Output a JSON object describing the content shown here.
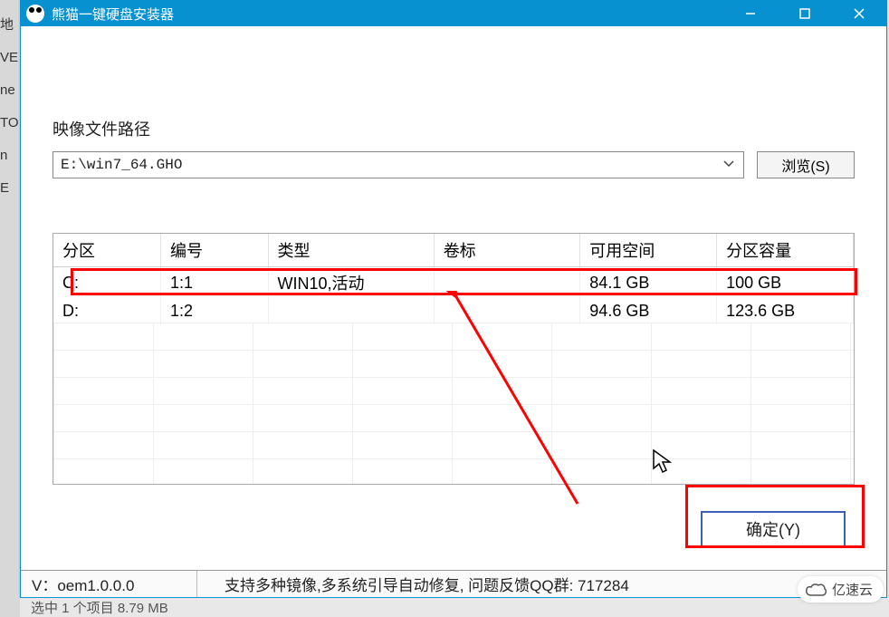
{
  "app_title": "熊猫一键硬盘安装器",
  "left_strip_text": "地\nVE\nne\nTO\nn\nE",
  "image_path_label": "映像文件路径",
  "image_path_value": "E:\\win7_64.GHO",
  "browse_label": "浏览(S)",
  "table": {
    "headers": {
      "partition": "分区",
      "number": "编号",
      "type": "类型",
      "volume": "卷标",
      "free": "可用空间",
      "capacity": "分区容量"
    },
    "rows": [
      {
        "partition": "C:",
        "number": "1:1",
        "type": "WIN10,活动",
        "volume": "",
        "free": "84.1 GB",
        "capacity": "100 GB"
      },
      {
        "partition": "D:",
        "number": "1:2",
        "type": "",
        "volume": "",
        "free": "94.6 GB",
        "capacity": "123.6 GB"
      }
    ]
  },
  "ok_label": "确定(Y)",
  "status": {
    "version": "V：oem1.0.0.0",
    "message": "支持多种镜像,多系统引导自动修复, 问题反馈QQ群: 717284"
  },
  "bottom_strip": "选中 1 个项目 8.79 MB",
  "watermark": "亿速云"
}
